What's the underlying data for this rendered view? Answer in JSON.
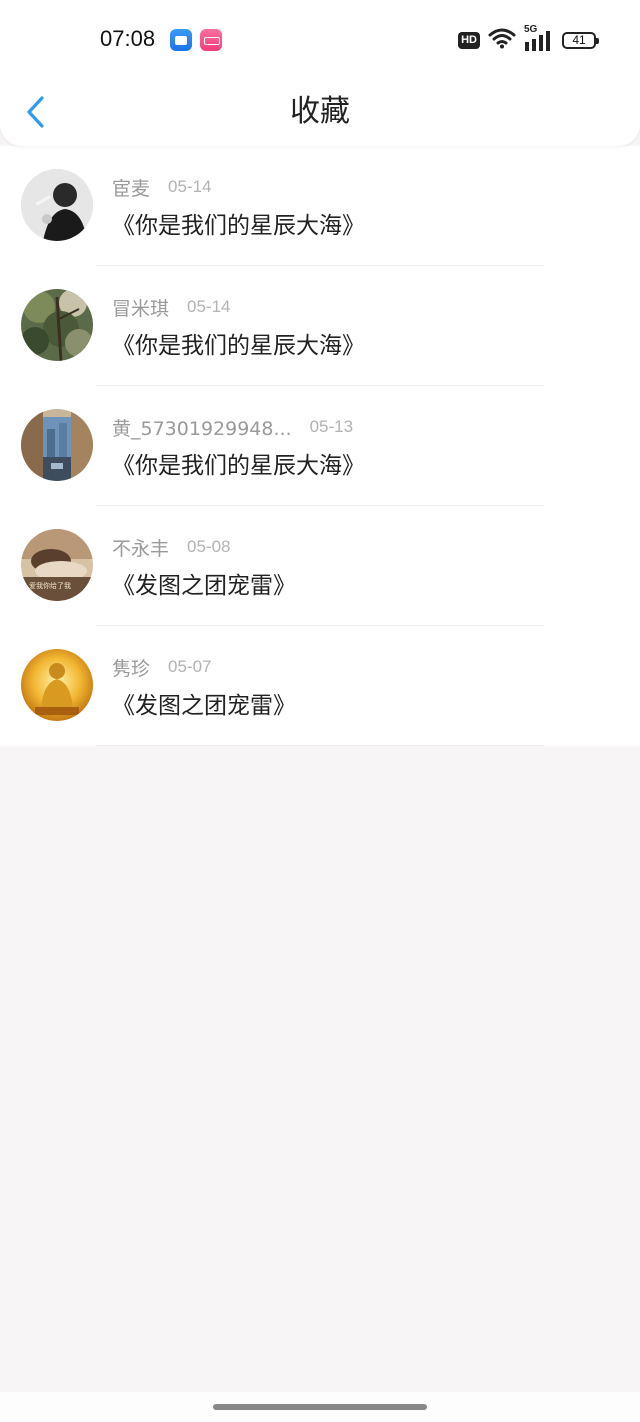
{
  "status_bar": {
    "time": "07:08",
    "hd_label": "HD",
    "network_label": "5G",
    "battery_level": "41",
    "notification_icons": [
      "calendar-app-icon",
      "pink-app-icon"
    ]
  },
  "header": {
    "title": "收藏",
    "back_icon": "chevron-left-icon",
    "accent_color": "#2f9bec"
  },
  "favorites": [
    {
      "name": "宦麦",
      "date": "05-14",
      "title": "《你是我们的星辰大海》",
      "avatar": "woman-smoking-portrait"
    },
    {
      "name": "冒米琪",
      "date": "05-14",
      "title": "《你是我们的星辰大海》",
      "avatar": "tree-foliage-photo"
    },
    {
      "name": "黄_57301929948...",
      "date": "05-13",
      "title": "《你是我们的星辰大海》",
      "avatar": "city-street-photo"
    },
    {
      "name": "不永丰",
      "date": "05-08",
      "title": "《发图之团宠雷》",
      "avatar": "person-resting-photo",
      "avatar_caption": "爱我你给了我"
    },
    {
      "name": "隽珍",
      "date": "05-07",
      "title": "《发图之团宠雷》",
      "avatar": "golden-buddha-image"
    }
  ],
  "colors": {
    "background": "#f7f5f6",
    "name_text": "#9a9a9a",
    "date_text": "#b3b3b3",
    "title_text": "#222222"
  }
}
